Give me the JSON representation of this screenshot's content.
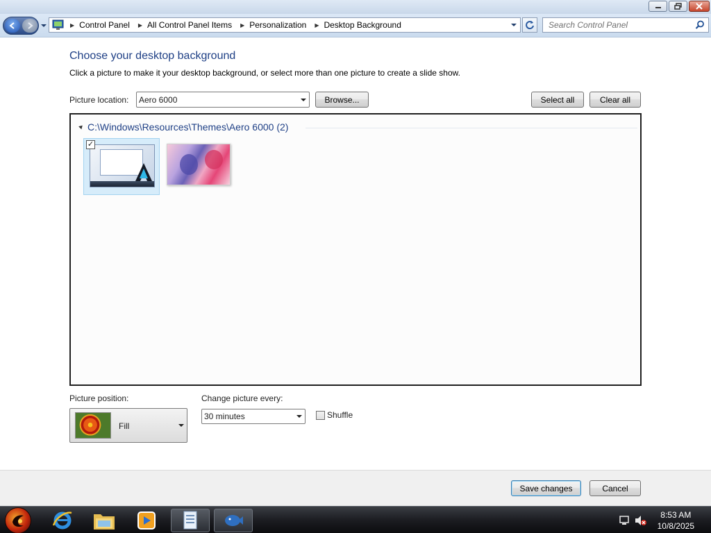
{
  "window": {
    "minimize_icon": "minimize-icon",
    "maximize_icon": "restore-icon",
    "close_icon": "close-icon"
  },
  "address_bar": {
    "breadcrumbs": [
      "Control Panel",
      "All Control Panel Items",
      "Personalization",
      "Desktop Background"
    ],
    "search_placeholder": "Search Control Panel"
  },
  "main": {
    "heading": "Choose your desktop background",
    "subtitle": "Click a picture to make it your desktop background, or select more than one picture to create a slide show.",
    "picture_location_label": "Picture location:",
    "picture_location_value": "Aero 6000",
    "browse_label": "Browse...",
    "select_all_label": "Select all",
    "clear_all_label": "Clear all",
    "group_title": "C:\\Windows\\Resources\\Themes\\Aero 6000 (2)",
    "thumbnails": [
      {
        "name": "aero-6000-screenshot",
        "selected": true
      },
      {
        "name": "anime-wallpaper",
        "selected": false
      }
    ],
    "picture_position_label": "Picture position:",
    "picture_position_value": "Fill",
    "change_picture_label": "Change picture every:",
    "change_picture_value": "30 minutes",
    "shuffle_label": "Shuffle",
    "shuffle_checked": false
  },
  "footer": {
    "save_label": "Save changes",
    "cancel_label": "Cancel"
  },
  "taskbar": {
    "items": [
      "start-orb",
      "internet-explorer-icon",
      "file-explorer-icon",
      "media-player-icon",
      "document-icon",
      "personalization-window-icon"
    ],
    "time": "8:53 AM",
    "date": "10/8/2025"
  }
}
